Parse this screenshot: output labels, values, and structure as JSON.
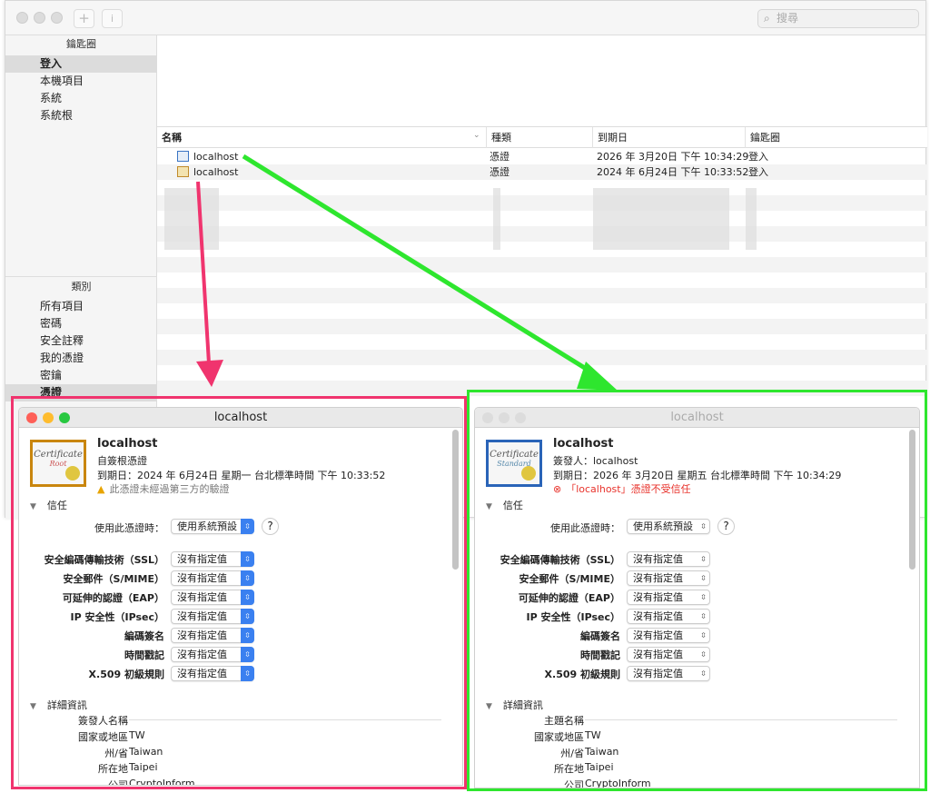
{
  "main": {
    "search_placeholder": "搜尋",
    "add_icon": "+",
    "info_icon": "i",
    "keychains_header": "鑰匙圈",
    "keychains": [
      {
        "label": "登入",
        "icon": "lock-open-icon",
        "selected": true
      },
      {
        "label": "本機項目",
        "icon": "lock-open-icon"
      },
      {
        "label": "系統",
        "icon": "lock-icon"
      },
      {
        "label": "系統根",
        "icon": "certificate-icon"
      }
    ],
    "category_header": "類別",
    "categories": [
      {
        "label": "所有項目",
        "icon": "all-items-icon"
      },
      {
        "label": "密碼",
        "icon": "password-icon"
      },
      {
        "label": "安全註釋",
        "icon": "note-icon"
      },
      {
        "label": "我的憑證",
        "icon": "my-certificate-icon"
      },
      {
        "label": "密鑰",
        "icon": "key-icon"
      },
      {
        "label": "憑證",
        "icon": "certificate-icon",
        "selected": true
      }
    ],
    "columns": [
      "名稱",
      "種類",
      "到期日",
      "鑰匙圈"
    ],
    "rows": [
      {
        "name": "localhost",
        "kind": "憑證",
        "expires": "2026 年 3月20日 下午 10:34:29",
        "keychain": "登入",
        "icon": "certificate-blue-icon"
      },
      {
        "name": "localhost",
        "kind": "憑證",
        "expires": "2024 年 6月24日 下午 10:33:52",
        "keychain": "登入",
        "icon": "certificate-gold-icon"
      }
    ]
  },
  "annotations": {
    "left_frame_color": "#f0346e",
    "right_frame_color": "#2ee62e"
  },
  "dialogs": [
    {
      "title": "localhost",
      "active": true,
      "cert_word": "Certificate",
      "cert_sub": "Root",
      "name": "localhost",
      "line1": "自簽根憑證",
      "expiry": "到期日：2024 年 6月24日 星期一 台北標準時間 下午 10:33:52",
      "status": "此憑證未經過第三方的驗證",
      "status_icon": "warning-icon",
      "status_color": "#777777",
      "trust_header": "信任",
      "when_label": "使用此憑證時：",
      "when_value": "使用系統預設",
      "help": "?",
      "trust_rows": [
        {
          "label": "安全編碼傳輸技術（SSL）",
          "value": "沒有指定值"
        },
        {
          "label": "安全郵件（S/MIME）",
          "value": "沒有指定值"
        },
        {
          "label": "可延伸的認證（EAP）",
          "value": "沒有指定值"
        },
        {
          "label": "IP 安全性（IPsec）",
          "value": "沒有指定值"
        },
        {
          "label": "編碼簽名",
          "value": "沒有指定值"
        },
        {
          "label": "時間戳記",
          "value": "沒有指定值"
        },
        {
          "label": "X.509 初級規則",
          "value": "沒有指定值"
        }
      ],
      "details_header": "詳細資訊",
      "details_section": "簽發人名稱",
      "details": [
        {
          "label": "國家或地區",
          "value": "TW"
        },
        {
          "label": "州/省",
          "value": "Taiwan"
        },
        {
          "label": "所在地",
          "value": "Taipei"
        },
        {
          "label": "公司",
          "value": "CryptoInform"
        }
      ]
    },
    {
      "title": "localhost",
      "active": false,
      "cert_word": "Certificate",
      "cert_sub": "Standard",
      "name": "localhost",
      "line1": "簽發人：localhost",
      "expiry": "到期日：2026 年 3月20日 星期五 台北標準時間 下午 10:34:29",
      "status": "「localhost」憑證不受信任",
      "status_icon": "error-icon",
      "status_color": "#e8322b",
      "trust_header": "信任",
      "when_label": "使用此憑證時：",
      "when_value": "使用系統預設",
      "help": "?",
      "trust_rows": [
        {
          "label": "安全編碼傳輸技術（SSL）",
          "value": "沒有指定值"
        },
        {
          "label": "安全郵件（S/MIME）",
          "value": "沒有指定值"
        },
        {
          "label": "可延伸的認證（EAP）",
          "value": "沒有指定值"
        },
        {
          "label": "IP 安全性（IPsec）",
          "value": "沒有指定值"
        },
        {
          "label": "編碼簽名",
          "value": "沒有指定值"
        },
        {
          "label": "時間戳記",
          "value": "沒有指定值"
        },
        {
          "label": "X.509 初級規則",
          "value": "沒有指定值"
        }
      ],
      "details_header": "詳細資訊",
      "details_section": "主題名稱",
      "details": [
        {
          "label": "國家或地區",
          "value": "TW"
        },
        {
          "label": "州/省",
          "value": "Taiwan"
        },
        {
          "label": "所在地",
          "value": "Taipei"
        },
        {
          "label": "公司",
          "value": "CryptoInform"
        }
      ]
    }
  ]
}
